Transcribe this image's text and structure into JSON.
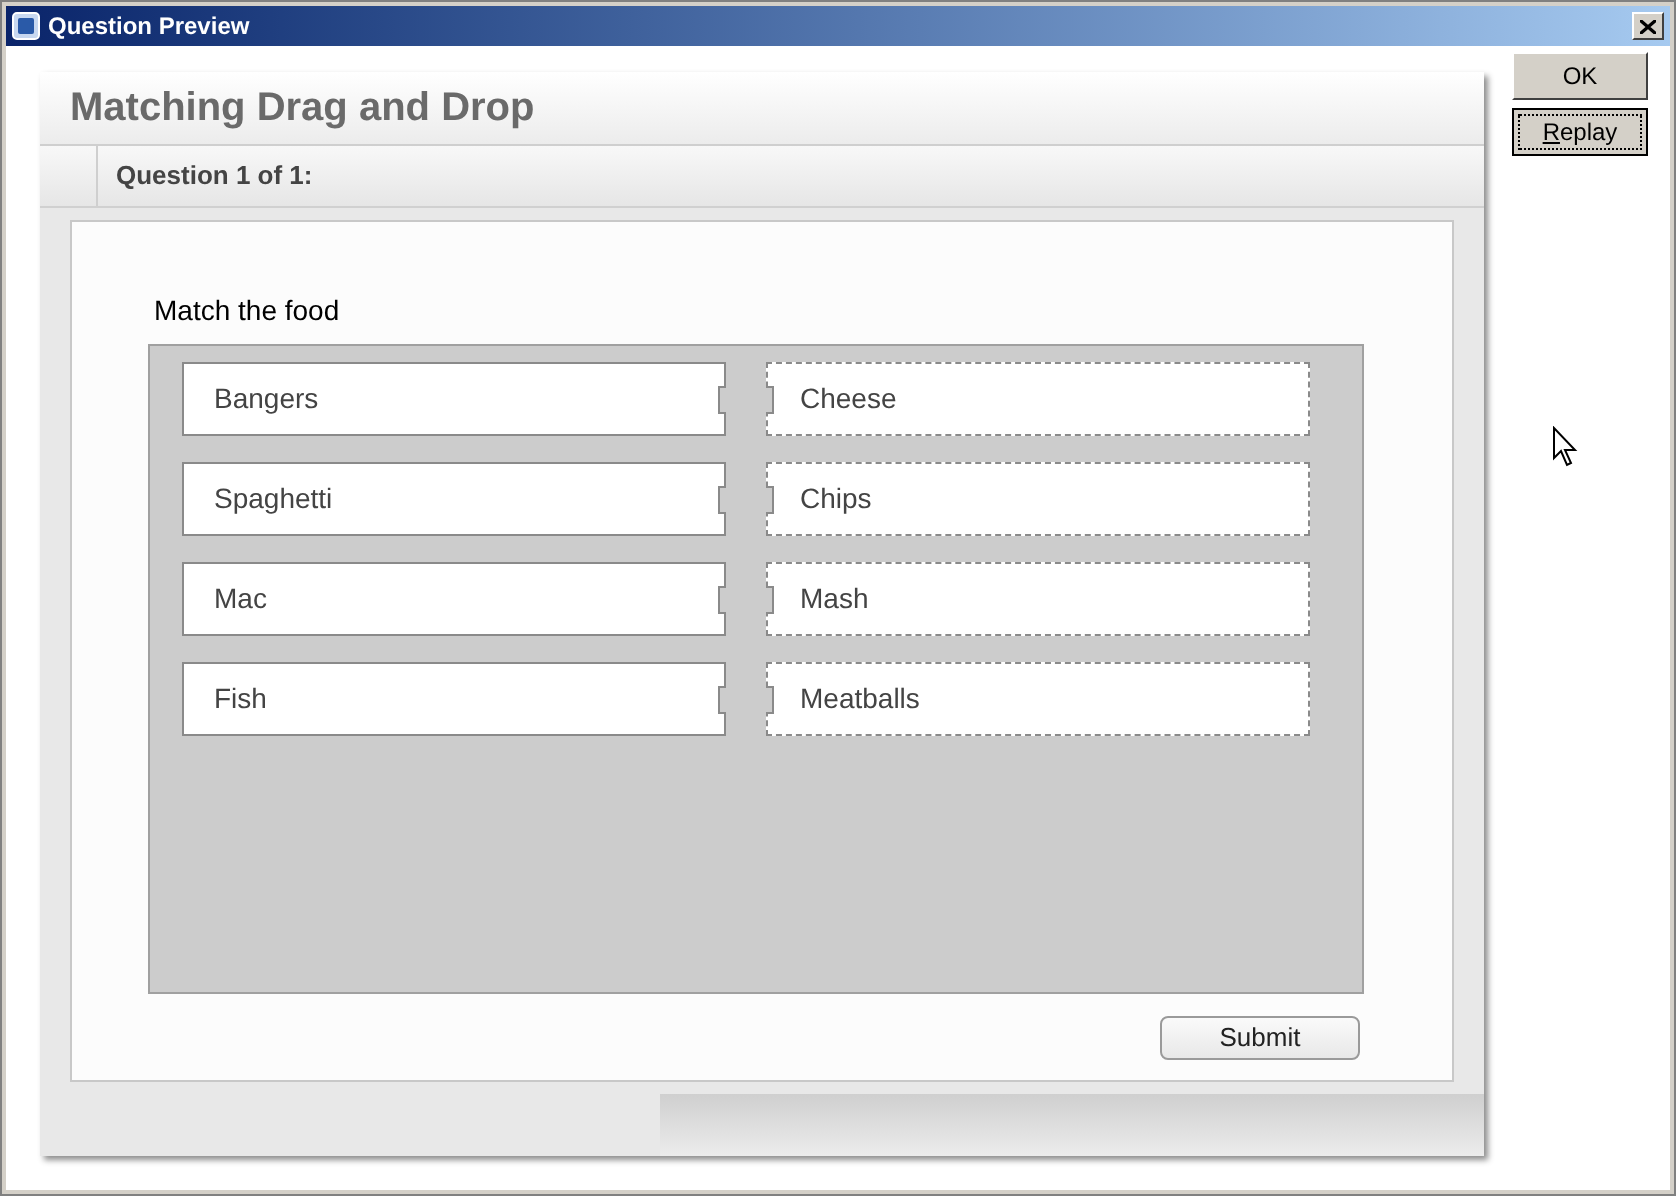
{
  "window": {
    "title": "Question Preview"
  },
  "side_buttons": [
    {
      "label": "OK",
      "focused": false
    },
    {
      "label": "Replay",
      "focused": true
    }
  ],
  "question": {
    "title": "Matching Drag and Drop",
    "counter": "Question 1 of 1:",
    "instruction": "Match the food",
    "sources": [
      "Bangers",
      "Spaghetti",
      "Mac",
      "Fish"
    ],
    "targets": [
      "Cheese",
      "Chips",
      "Mash",
      "Meatballs"
    ],
    "submit": "Submit"
  }
}
